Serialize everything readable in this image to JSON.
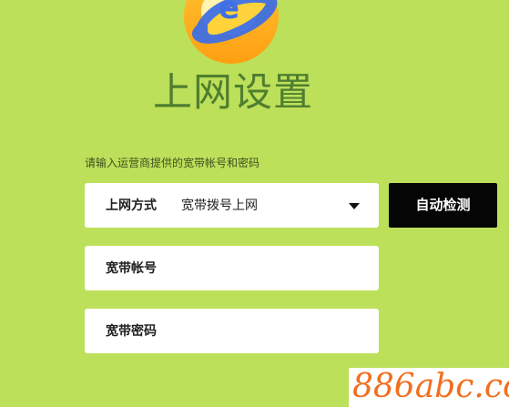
{
  "page": {
    "title": "上网设置",
    "hint": "请输入运营商提供的宽带帐号和密码"
  },
  "connection": {
    "label": "上网方式",
    "value": "宽带拨号上网",
    "caret_icon": "chevron-down-icon"
  },
  "detect_button": {
    "label": "自动检测"
  },
  "account": {
    "label": "宽带帐号"
  },
  "password": {
    "label": "宽带密码"
  },
  "watermark": {
    "text": "886abc.com"
  },
  "logo": {
    "icon": "browser-logo-icon"
  },
  "colors": {
    "background": "#bde05a",
    "title": "#4f7e2f",
    "button": "#050505",
    "input": "#ffffff",
    "watermark": "#f16f1e"
  }
}
